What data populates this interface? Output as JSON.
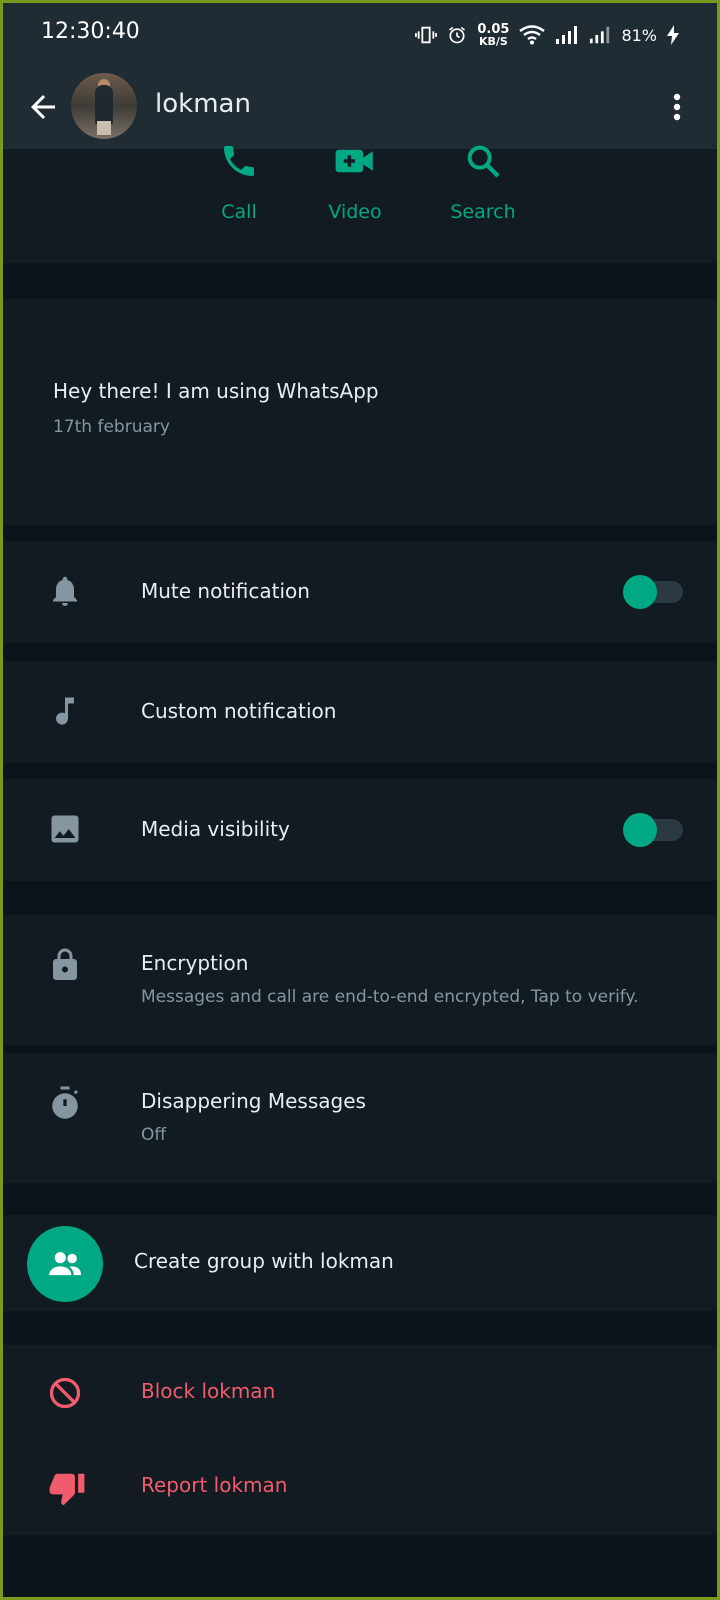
{
  "status_bar": {
    "time": "12:30:40",
    "net_speed_value": "0.05",
    "net_speed_unit": "KB/S",
    "battery": "81%"
  },
  "header": {
    "contact_name": "lokman"
  },
  "actions": [
    {
      "label": "Call",
      "icon": "phone-icon"
    },
    {
      "label": "Video",
      "icon": "video-icon"
    },
    {
      "label": "Search",
      "icon": "search-icon"
    }
  ],
  "about": {
    "text": "Hey there! I am using WhatsApp",
    "date": "17th february"
  },
  "settings": {
    "mute": {
      "title": "Mute notification",
      "icon": "bell-icon",
      "enabled": true
    },
    "custom": {
      "title": "Custom notification",
      "icon": "music-note-icon"
    },
    "media": {
      "title": "Media visibility",
      "icon": "image-icon",
      "enabled": true
    },
    "encryption": {
      "title": "Encryption",
      "subtitle": "Messages and call are end-to-end encrypted, Tap to verify.",
      "icon": "lock-icon"
    },
    "disappearing": {
      "title": "Disappering Messages",
      "subtitle": "Off",
      "icon": "timer-icon"
    }
  },
  "group": {
    "label": "Create group with lokman",
    "icon": "group-icon"
  },
  "danger": {
    "block": {
      "label": "Block lokman",
      "icon": "block-icon"
    },
    "report": {
      "label": "Report lokman",
      "icon": "thumbs-down-icon"
    }
  },
  "colors": {
    "accent": "#00a884",
    "danger": "#f15c6d",
    "background": "#0b141a",
    "panel": "#111b21",
    "header": "#202c33"
  }
}
